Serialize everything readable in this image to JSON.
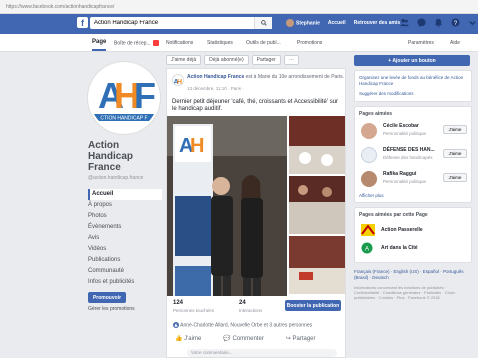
{
  "browser": {
    "url": "https://www.facebook.com/actionhandicapfrance/"
  },
  "topbar": {
    "search_value": "Action Handicap France",
    "user_name": "Stephanie",
    "home_label": "Accueil",
    "find_friends_label": "Retrouver des amis"
  },
  "tabs": {
    "page": "Page",
    "inbox": "Boîte de récep...",
    "notifications": "Notifications",
    "insights": "Statistiques",
    "publishing_tools": "Outils de publ...",
    "promotions": "Promotions",
    "settings": "Paramètres",
    "help": "Aide"
  },
  "profile": {
    "name": "Action Handicap France",
    "handle": "@action.handicap.france"
  },
  "left_nav": [
    "Accueil",
    "À propos",
    "Photos",
    "Évènements",
    "Avis",
    "Vidéos",
    "Publications",
    "Communauté",
    "Infos et publicités"
  ],
  "left_promote": "Promouvoir",
  "left_manage": "Gérer les promotions",
  "composer": {
    "liked": "J'aime déjà",
    "following": "Déjà abonné(e)",
    "share": "Partager",
    "more": "···"
  },
  "post": {
    "author": "Action Handicap France",
    "author_suffix": " est à Marie du 10e arrondissement de Paris.",
    "time": "13 décembre, 11:10 · Paris ·",
    "text": "Dernier petit déjeuner 'café, thé, croissants et Accessibilité' sur le handicap auditif.",
    "reach_count": "124",
    "reach_label": "Personnes touchées",
    "interactions_count": "24",
    "interactions_label": "Interactions",
    "boost_label": "Booster la publication",
    "reactors": "Anne-Charlotte Allard, Nouvelle Orbe et 3 autres personnes",
    "like": "J'aime",
    "comment": "Commenter",
    "share": "Partager",
    "comment_placeholder": "Votre commentaire..."
  },
  "right": {
    "cta": "+ Ajouter un bouton",
    "organize": "Organisez une levée de fonds au bénéfice de Action Handicap France",
    "suggest": "Suggérer des modifications",
    "liked_title": "Pages aimées",
    "liked_pages": [
      {
        "name": "Cécile Escobar",
        "desc": "Personnalité politique",
        "btn": "J'aime"
      },
      {
        "name": "DÉFENSE DES HAN...",
        "desc": "Défense des handicapés",
        "btn": "J'aime"
      },
      {
        "name": "Rafika Raggui",
        "desc": "Personnalité politique",
        "btn": "J'aime"
      }
    ],
    "see_all": "Afficher plus",
    "fav_title": "Pages aimées par cette Page",
    "favs": [
      "Action Passerelle",
      "Art dans la Cité"
    ],
    "lang": "Français (France) · English (US) · Español · Português (Brasil) · Deutsch",
    "footer": "Informations concernant les fonctions de publicités · Confidentialité · Conditions générales · Publicités · Choix publicitaires · Cookies · Plus · Facebook © 2018"
  },
  "colors": {
    "brand": "#4267b2",
    "logo_blue": "#2f6fb5",
    "logo_orange": "#f08a24"
  }
}
